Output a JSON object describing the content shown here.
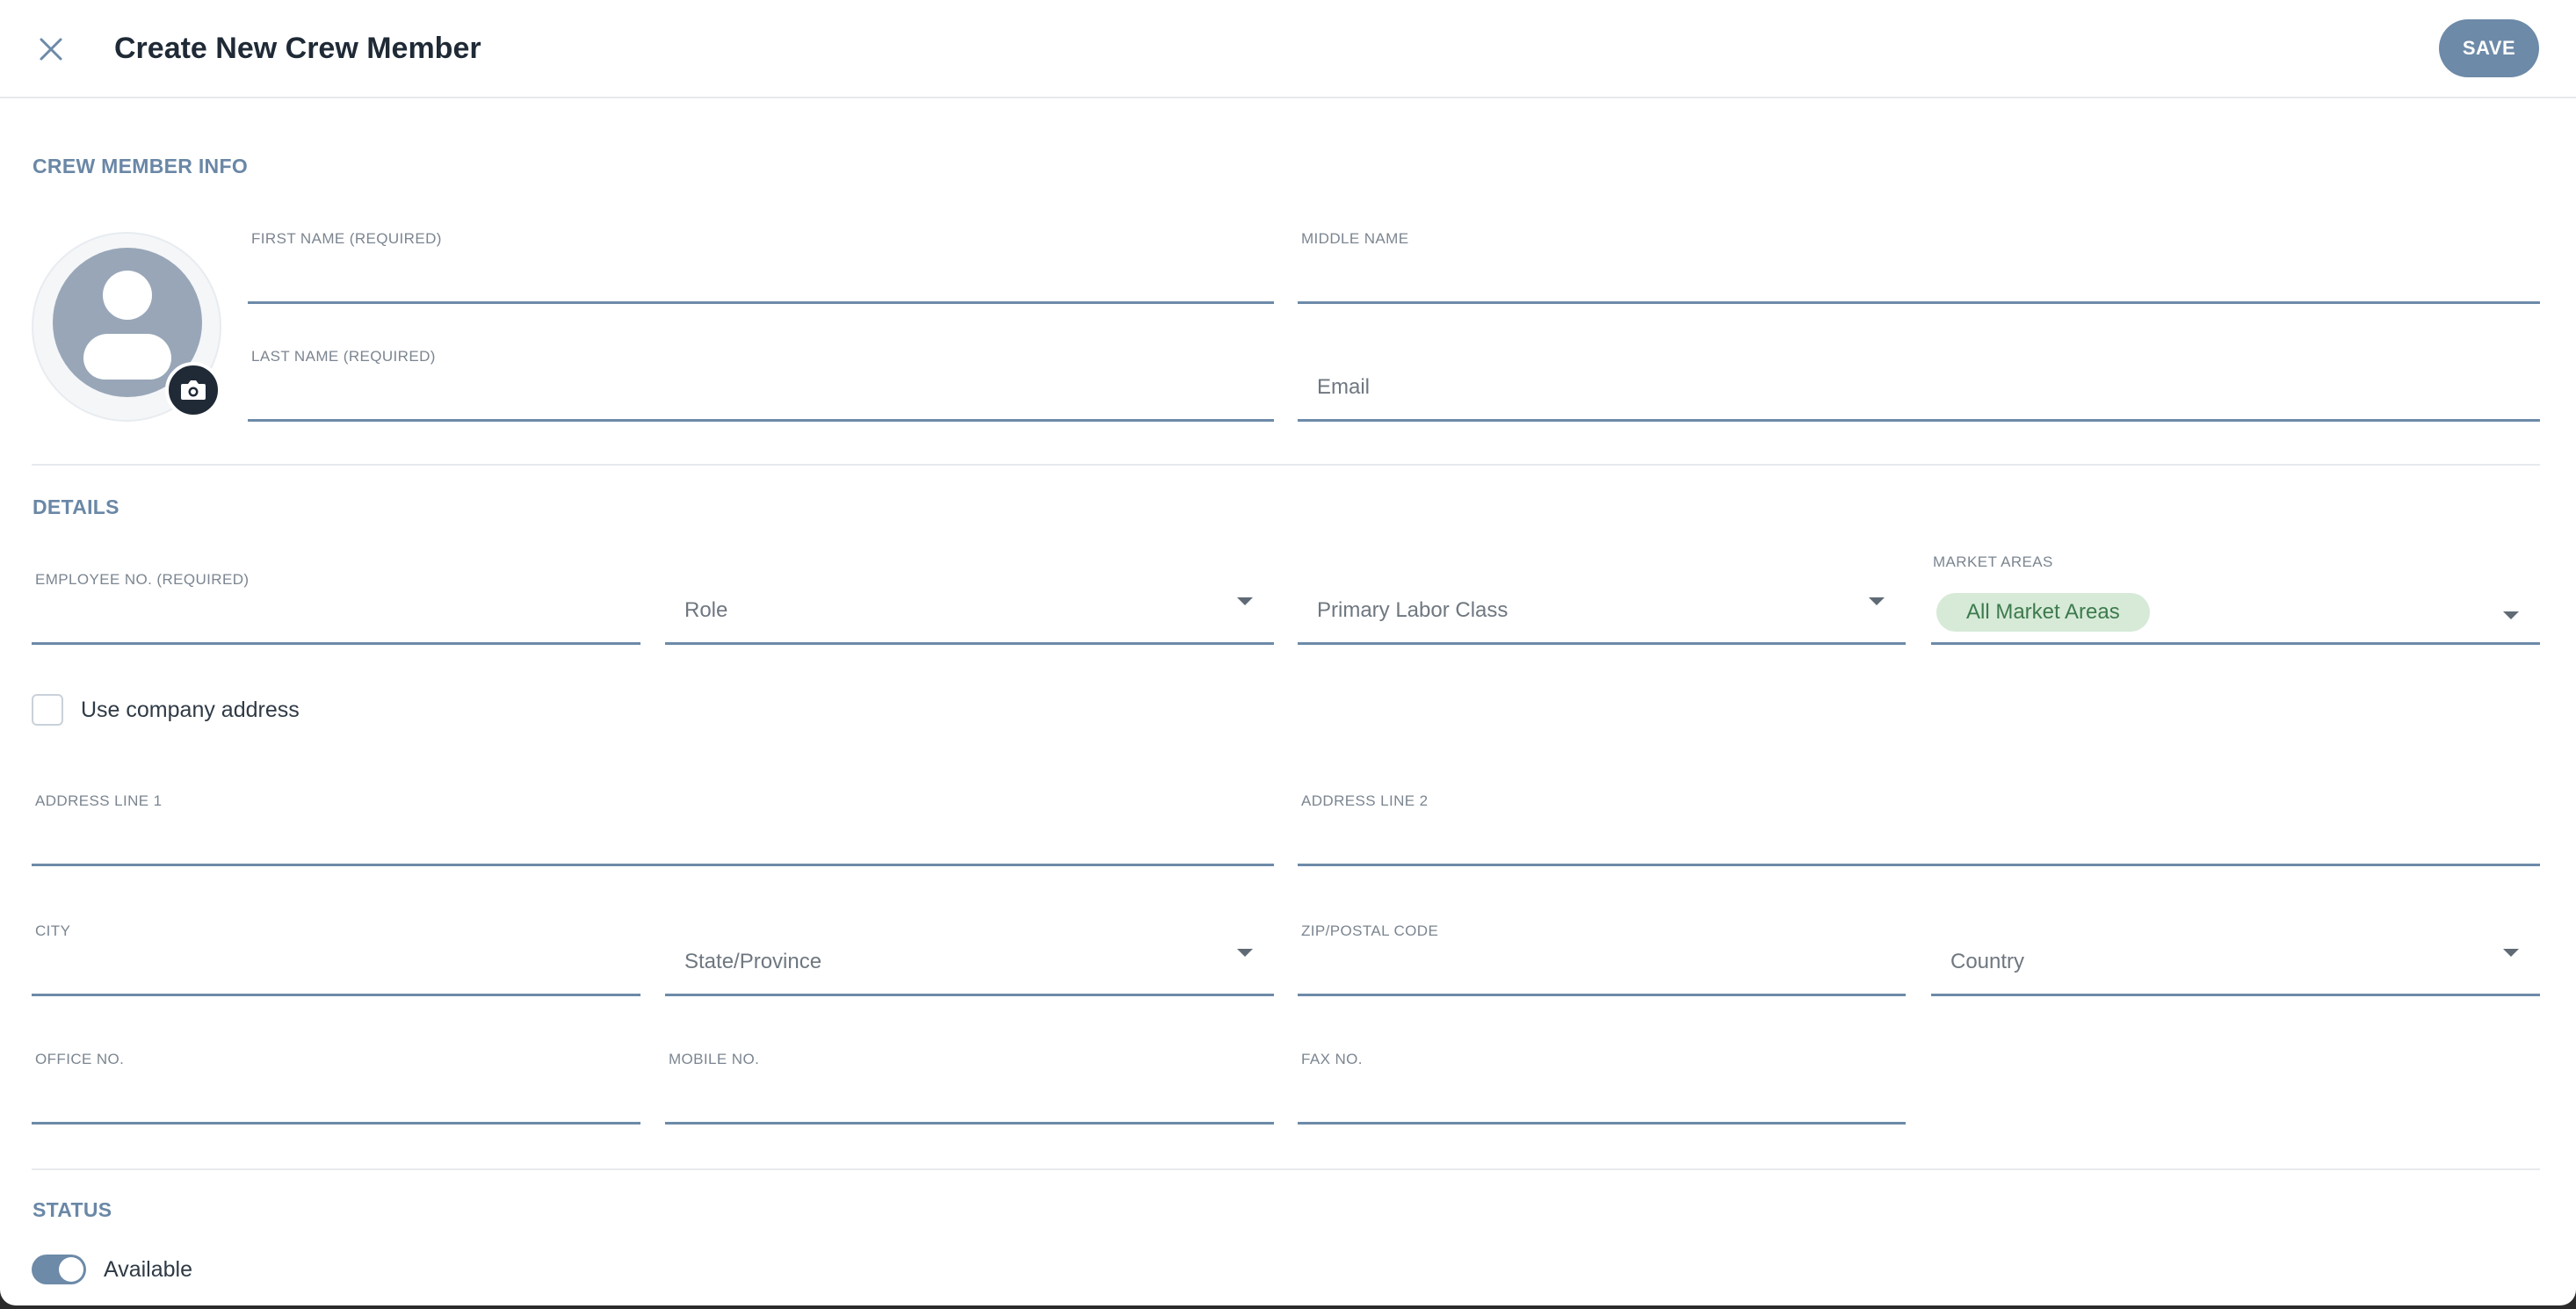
{
  "header": {
    "title": "Create New Crew Member",
    "save_label": "SAVE"
  },
  "sections": {
    "info_title": "CREW MEMBER INFO",
    "details_title": "DETAILS",
    "status_title": "STATUS"
  },
  "info": {
    "first_name_label": "FIRST NAME (REQUIRED)",
    "first_name_value": "",
    "middle_name_label": "MIDDLE NAME",
    "middle_name_value": "",
    "last_name_label": "LAST NAME (REQUIRED)",
    "last_name_value": "",
    "email_placeholder": "Email"
  },
  "details": {
    "employee_no_label": "EMPLOYEE NO. (REQUIRED)",
    "employee_no_value": "",
    "role_placeholder": "Role",
    "labor_class_placeholder": "Primary Labor Class",
    "market_areas_label": "MARKET AREAS",
    "market_areas_chip": "All Market Areas",
    "use_company_address_label": "Use company address",
    "use_company_address_checked": false,
    "address1_label": "ADDRESS LINE 1",
    "address2_label": "ADDRESS LINE 2",
    "city_label": "CITY",
    "state_placeholder": "State/Province",
    "zip_label": "ZIP/POSTAL CODE",
    "country_placeholder": "Country",
    "office_label": "OFFICE NO.",
    "mobile_label": "MOBILE NO.",
    "fax_label": "FAX NO."
  },
  "status": {
    "available_label": "Available",
    "available_on": true
  },
  "icons": {
    "close": "close-icon",
    "camera": "camera-icon",
    "avatar": "user-avatar-icon",
    "dropdown": "chevron-down-icon"
  },
  "colors": {
    "accent": "#6d8aa8",
    "section_title": "#6a87a6",
    "chip_bg": "#d6ead7",
    "chip_text": "#3d7a4d"
  }
}
